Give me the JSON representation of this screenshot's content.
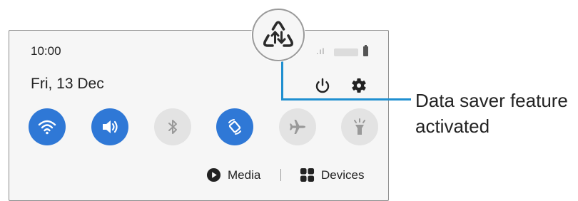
{
  "status_bar": {
    "time": "10:00",
    "signal": ".ıl"
  },
  "header": {
    "date": "Fri, 13 Dec"
  },
  "quick_toggles": [
    {
      "name": "wifi",
      "state": "on",
      "icon": "wifi-icon"
    },
    {
      "name": "sound",
      "state": "on",
      "icon": "volume-icon"
    },
    {
      "name": "bluetooth",
      "state": "off",
      "icon": "bluetooth-icon"
    },
    {
      "name": "auto-rotate",
      "state": "on",
      "icon": "auto-rotate-icon"
    },
    {
      "name": "airplane-mode",
      "state": "off",
      "icon": "airplane-icon"
    },
    {
      "name": "flashlight",
      "state": "off",
      "icon": "flashlight-icon"
    }
  ],
  "bottom": {
    "media_label": "Media",
    "devices_label": "Devices"
  },
  "callout": {
    "line1": "Data saver feature",
    "line2": "activated",
    "icon": "data-saver-icon"
  },
  "colors": {
    "accent": "#2f78d6",
    "callout_line": "#1f8fd0",
    "panel_bg": "#f6f6f6"
  }
}
